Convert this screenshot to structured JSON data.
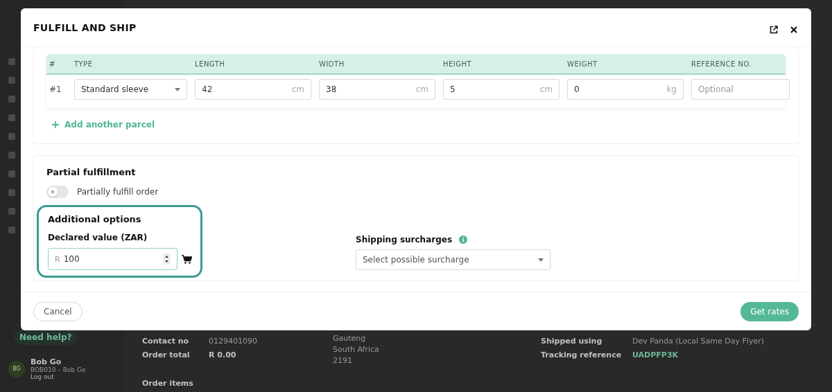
{
  "modal": {
    "title": "FULFILL AND SHIP"
  },
  "parcels": {
    "columns": [
      "#",
      "TYPE",
      "LENGTH",
      "WIDTH",
      "HEIGHT",
      "WEIGHT",
      "REFERENCE NO."
    ],
    "rows": [
      {
        "number": "#1",
        "type": "Standard sleeve",
        "measures": [
          {
            "value": "42",
            "unit": "cm"
          },
          {
            "value": "38",
            "unit": "cm"
          },
          {
            "value": "5",
            "unit": "cm"
          },
          {
            "value": "0",
            "unit": "kg"
          }
        ],
        "reference_placeholder": "Optional"
      }
    ],
    "add_label": "Add another parcel"
  },
  "partial": {
    "heading": "Partial fulfillment",
    "toggle": {
      "label": "Partially fulfill order",
      "on": false
    }
  },
  "additional": {
    "heading": "Additional options",
    "highlighted": true,
    "declared": {
      "label": "Declared value (ZAR)",
      "prefix": "R",
      "value": "100"
    },
    "surcharges": {
      "label": "Shipping surcharges",
      "placeholder": "Select possible surcharge"
    }
  },
  "footer": {
    "cancel": "Cancel",
    "submit": "Get rates"
  },
  "background": {
    "help": "Need help?",
    "user": {
      "initials": "BG",
      "name": "Bob Go",
      "account": "BOB010 – Bob Go",
      "logout": "Log out"
    },
    "details": [
      {
        "label": "Contact no",
        "value": "0129401090",
        "kind": "plain"
      },
      {
        "label": "Order total",
        "value": "R 0.00",
        "kind": "bold"
      }
    ],
    "address": [
      "Gauteng",
      "South Africa",
      "2191"
    ],
    "shipping": [
      {
        "label": "Shipped using",
        "value": "Dev Panda (Local Same Day Flyer)",
        "kind": "plain"
      },
      {
        "label": "Tracking reference",
        "value": "UADPFP3K",
        "kind": "link"
      }
    ],
    "section": "Order items"
  }
}
